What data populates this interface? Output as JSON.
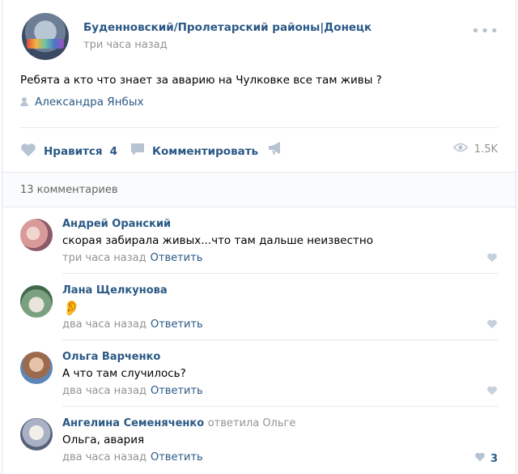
{
  "post": {
    "group_name": "Буденновский/Пролетарский районы|Донецк",
    "time": "три часа назад",
    "more_icon": "more-dots-icon",
    "text": "Ребята а кто что знает за аварию на Чулковке все там живы ?",
    "author": "Александра Янбых",
    "actions": {
      "like_label": "Нравится",
      "like_count": "4",
      "comment_label": "Комментировать",
      "views": "1.5K"
    }
  },
  "comments_header": {
    "count_text": "13 комментариев"
  },
  "comments": [
    {
      "name": "Андрей Оранский",
      "reply_to": "",
      "text": "скорая забирала живых...что там дальше неизвестно",
      "time": "три часа назад",
      "reply_label": "Ответить",
      "likes": ""
    },
    {
      "name": "Лана Щелкунова",
      "reply_to": "",
      "text": "👂",
      "time": "два часа назад",
      "reply_label": "Ответить",
      "likes": ""
    },
    {
      "name": "Ольга Варченко",
      "reply_to": "",
      "text": "А что там случилось?",
      "time": "два часа назад",
      "reply_label": "Ответить",
      "likes": ""
    },
    {
      "name": "Ангелина Семеняченко",
      "reply_to": "ответила Ольге",
      "text": "Ольга, авария",
      "time": "два часа назад",
      "reply_label": "Ответить",
      "likes": "3"
    }
  ],
  "colors": {
    "link": "#2a5885",
    "muted": "#939393",
    "icon": "#b7c3d0",
    "divider": "#e7e8ec"
  }
}
